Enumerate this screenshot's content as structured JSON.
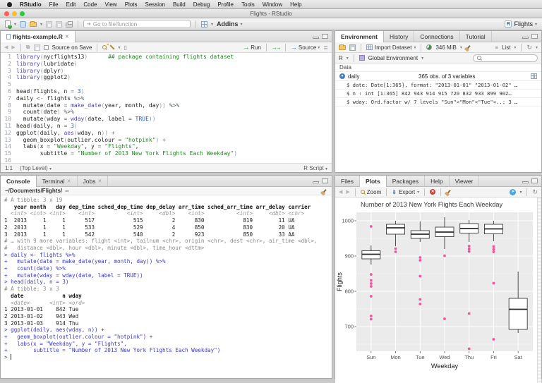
{
  "colors": {
    "fn": "#5345b7",
    "comment": "#1f8a1f",
    "string": "#1f8a1f",
    "number": "#2157d6",
    "cmd": "#3a3acd",
    "hotpink": "#f0559f"
  },
  "macos_menu": {
    "items": [
      "RStudio",
      "File",
      "Edit",
      "Code",
      "View",
      "Plots",
      "Session",
      "Build",
      "Debug",
      "Profile",
      "Tools",
      "Window",
      "Help"
    ]
  },
  "window": {
    "title": "Flights - RStudio"
  },
  "main_toolbar": {
    "goto_placeholder": "Go to file/function",
    "addins_label": "Addins",
    "project_label": "Flights"
  },
  "source_pane": {
    "tab_label": "flights-example.R",
    "source_on_save_label": "Source on Save",
    "run_label": "Run",
    "source_label": "Source",
    "cursor_pos": "1:1",
    "scope_label": "(Top Level)",
    "file_type_label": "R Script",
    "code_lines": [
      [
        [
          "fn",
          "library"
        ],
        [
          "pa",
          "("
        ],
        [
          "tx",
          "nycflights13"
        ],
        [
          "pa",
          ")"
        ],
        [
          "tx",
          "      "
        ],
        [
          "co",
          "## package containing flights dataset"
        ]
      ],
      [
        [
          "fn",
          "library"
        ],
        [
          "pa",
          "("
        ],
        [
          "tx",
          "lubridate"
        ],
        [
          "pa",
          ")"
        ]
      ],
      [
        [
          "fn",
          "library"
        ],
        [
          "pa",
          "("
        ],
        [
          "tx",
          "dplyr"
        ],
        [
          "pa",
          ")"
        ]
      ],
      [
        [
          "fn",
          "library"
        ],
        [
          "pa",
          "("
        ],
        [
          "tx",
          "ggplot2"
        ],
        [
          "pa",
          ")"
        ]
      ],
      [],
      [
        [
          "tx",
          "head"
        ],
        [
          "pa",
          "("
        ],
        [
          "tx",
          "flights, n "
        ],
        [
          "op",
          "="
        ],
        [
          "nu",
          " 3"
        ],
        [
          "pa",
          ")"
        ]
      ],
      [
        [
          "tx",
          "daily "
        ],
        [
          "op",
          "<-"
        ],
        [
          "tx",
          " flights "
        ],
        [
          "op",
          "%>%"
        ]
      ],
      [
        [
          "tx",
          "  mutate"
        ],
        [
          "pa",
          "("
        ],
        [
          "tx",
          "date "
        ],
        [
          "op",
          "="
        ],
        [
          "tx",
          " "
        ],
        [
          "fn",
          "make_date"
        ],
        [
          "pa",
          "("
        ],
        [
          "tx",
          "year, month, day"
        ],
        [
          "pa",
          "))"
        ],
        [
          "op",
          " %>%"
        ]
      ],
      [
        [
          "tx",
          "  count"
        ],
        [
          "pa",
          "("
        ],
        [
          "tx",
          "date"
        ],
        [
          "pa",
          ")"
        ],
        [
          "op",
          " %>%"
        ]
      ],
      [
        [
          "tx",
          "  mutate"
        ],
        [
          "pa",
          "("
        ],
        [
          "tx",
          "wday "
        ],
        [
          "op",
          "="
        ],
        [
          "tx",
          " "
        ],
        [
          "fn",
          "wday"
        ],
        [
          "pa",
          "("
        ],
        [
          "tx",
          "date, label "
        ],
        [
          "op",
          "="
        ],
        [
          "kw",
          " TRUE"
        ],
        [
          "pa",
          "))"
        ]
      ],
      [
        [
          "tx",
          "head"
        ],
        [
          "pa",
          "("
        ],
        [
          "tx",
          "daily, n "
        ],
        [
          "op",
          "="
        ],
        [
          "nu",
          " 3"
        ],
        [
          "pa",
          ")"
        ]
      ],
      [
        [
          "tx",
          "ggplot"
        ],
        [
          "pa",
          "("
        ],
        [
          "tx",
          "daily, "
        ],
        [
          "fn",
          "aes"
        ],
        [
          "pa",
          "("
        ],
        [
          "tx",
          "wday, n"
        ],
        [
          "pa",
          "))"
        ],
        [
          "op",
          " +"
        ]
      ],
      [
        [
          "tx",
          "  geom_boxplot"
        ],
        [
          "pa",
          "("
        ],
        [
          "tx",
          "outlier.colour "
        ],
        [
          "op",
          "="
        ],
        [
          "st",
          " \"hotpink\""
        ],
        [
          "pa",
          ")"
        ],
        [
          "op",
          " +"
        ]
      ],
      [
        [
          "tx",
          "  labs"
        ],
        [
          "pa",
          "("
        ],
        [
          "tx",
          "x "
        ],
        [
          "op",
          "="
        ],
        [
          "st",
          " \"Weekday\""
        ],
        [
          "tx",
          ", y "
        ],
        [
          "op",
          "="
        ],
        [
          "st",
          " \"Flights\""
        ],
        [
          "tx",
          ","
        ]
      ],
      [
        [
          "tx",
          "       subtitle "
        ],
        [
          "op",
          "="
        ],
        [
          "st",
          " \"Number of 2013 New York Flights Each Weekday\""
        ],
        [
          "pa",
          ")"
        ]
      ],
      []
    ]
  },
  "console_pane": {
    "tabs": [
      {
        "label": "Console",
        "active": true
      },
      {
        "label": "Terminal",
        "closable": true
      },
      {
        "label": "Jobs",
        "closable": true
      }
    ],
    "working_dir": "~/Documents/Flights/",
    "lines": [
      {
        "c": "meta",
        "t": "# A tibble: 3 x 19"
      },
      {
        "c": "hdr",
        "t": "   year month   day dep_time sched_dep_time dep_delay arr_time sched_arr_time arr_delay carrier"
      },
      {
        "c": "typ",
        "t": "  <int> <int> <int>    <int>          <int>     <dbl>    <int>          <int>     <dbl> <chr>"
      },
      {
        "c": "out",
        "t": "1  2013     1     1      517            515         2      830            819        11 UA"
      },
      {
        "c": "out",
        "t": "2  2013     1     1      533            529         4      850            830        20 UA"
      },
      {
        "c": "out",
        "t": "3  2013     1     1      542            540         2      923            850        33 AA"
      },
      {
        "c": "meta",
        "t": "# … with 9 more variables: flight <int>, tailnum <chr>, origin <chr>, dest <chr>, air_time <dbl>,"
      },
      {
        "c": "meta",
        "t": "#   distance <dbl>, hour <dbl>, minute <dbl>, time_hour <dttm>"
      },
      {
        "c": "cmd",
        "t": "> daily <- flights %>%"
      },
      {
        "c": "cmd",
        "t": "+   mutate(date = make_date(year, month, day)) %>%"
      },
      {
        "c": "cmd",
        "t": "+   count(date) %>%"
      },
      {
        "c": "cmd",
        "t": "+   mutate(wday = wday(date, label = TRUE))"
      },
      {
        "c": "cmd",
        "t": "> head(daily, n = 3)"
      },
      {
        "c": "meta",
        "t": "# A tibble: 3 x 3"
      },
      {
        "c": "hdr",
        "t": "  date            n wday"
      },
      {
        "c": "typ",
        "t": "  <date>      <int> <ord>"
      },
      {
        "c": "out",
        "t": "1 2013-01-01    842 Tue"
      },
      {
        "c": "out",
        "t": "2 2013-01-02    943 Wed"
      },
      {
        "c": "out",
        "t": "3 2013-01-03    914 Thu"
      },
      {
        "c": "cmd",
        "t": "> ggplot(daily, aes(wday, n)) +"
      },
      {
        "c": "cmd",
        "t": "+   geom_boxplot(outlier.colour = \"hotpink\") +"
      },
      {
        "c": "cmd",
        "t": "+   labs(x = \"Weekday\", y = \"Flights\","
      },
      {
        "c": "cmd",
        "t": "+        subtitle = \"Number of 2013 New York Flights Each Weekday\")"
      },
      {
        "c": "cmd",
        "t": "> ",
        "cursor": true
      }
    ]
  },
  "environment_pane": {
    "tabs": [
      {
        "label": "Environment",
        "active": true
      },
      {
        "label": "History"
      },
      {
        "label": "Connections"
      },
      {
        "label": "Tutorial"
      }
    ],
    "import_label": "Import Dataset",
    "memory_label": "346 MiB",
    "list_label": "List",
    "language_label": "R",
    "scope_label": "Global Environment",
    "search_placeholder": "",
    "section_label": "Data",
    "object_name": "daily",
    "object_desc": "365 obs. of 3 variables",
    "fields": [
      "$ date: Date[1:365], format: \"2013-01-01\" \"2013-01-02\" …",
      "$ n   : int [1:365]  842 943 914 915 720 832 933 899 902…",
      "$ wday: Ord.factor w/ 7 levels \"Sun\"<\"Mon\"<\"Tue\"<..: 3 …"
    ]
  },
  "plots_pane": {
    "tabs": [
      {
        "label": "Files"
      },
      {
        "label": "Plots",
        "active": true
      },
      {
        "label": "Packages"
      },
      {
        "label": "Help"
      },
      {
        "label": "Viewer"
      }
    ],
    "zoom_label": "Zoom",
    "export_label": "Export"
  },
  "chart_data": {
    "type": "boxplot",
    "title": "Number of 2013 New York Flights Each Weekday",
    "xlabel": "Weekday",
    "ylabel": "Flights",
    "categories": [
      "Sun",
      "Mon",
      "Tue",
      "Wed",
      "Thu",
      "Fri",
      "Sat"
    ],
    "yticks": [
      700,
      800,
      900,
      1000
    ],
    "ylim": [
      630,
      1024
    ],
    "grid": true,
    "panel_background": "#ebebeb",
    "outlier_color": "#f0559f",
    "series": [
      {
        "category": "Sun",
        "low": 876,
        "q1": 892,
        "median": 905,
        "q3": 915,
        "high": 930,
        "outliers": [
          984,
          848,
          831,
          822,
          814,
          786,
          730,
          721
        ]
      },
      {
        "category": "Mon",
        "low": 928,
        "q1": 962,
        "median": 980,
        "q3": 990,
        "high": 1000,
        "outliers": [
          921,
          912
        ]
      },
      {
        "category": "Tue",
        "low": 940,
        "q1": 950,
        "median": 962,
        "q3": 972,
        "high": 998,
        "outliers": [
          896,
          888,
          843,
          777,
          764
        ]
      },
      {
        "category": "Wed",
        "low": 920,
        "q1": 955,
        "median": 968,
        "q3": 982,
        "high": 1010,
        "outliers": [
          901,
          722
        ]
      },
      {
        "category": "Thu",
        "low": 940,
        "q1": 965,
        "median": 978,
        "q3": 992,
        "high": 1002,
        "outliers": [
          928,
          920,
          913,
          737,
          637
        ]
      },
      {
        "category": "Fri",
        "low": 942,
        "q1": 963,
        "median": 977,
        "q3": 990,
        "high": 1000,
        "outliers": [
          927,
          919,
          912,
          823,
          664
        ]
      },
      {
        "category": "Sat",
        "low": 682,
        "q1": 692,
        "median": 749,
        "q3": 780,
        "high": 856,
        "outliers": []
      }
    ]
  }
}
